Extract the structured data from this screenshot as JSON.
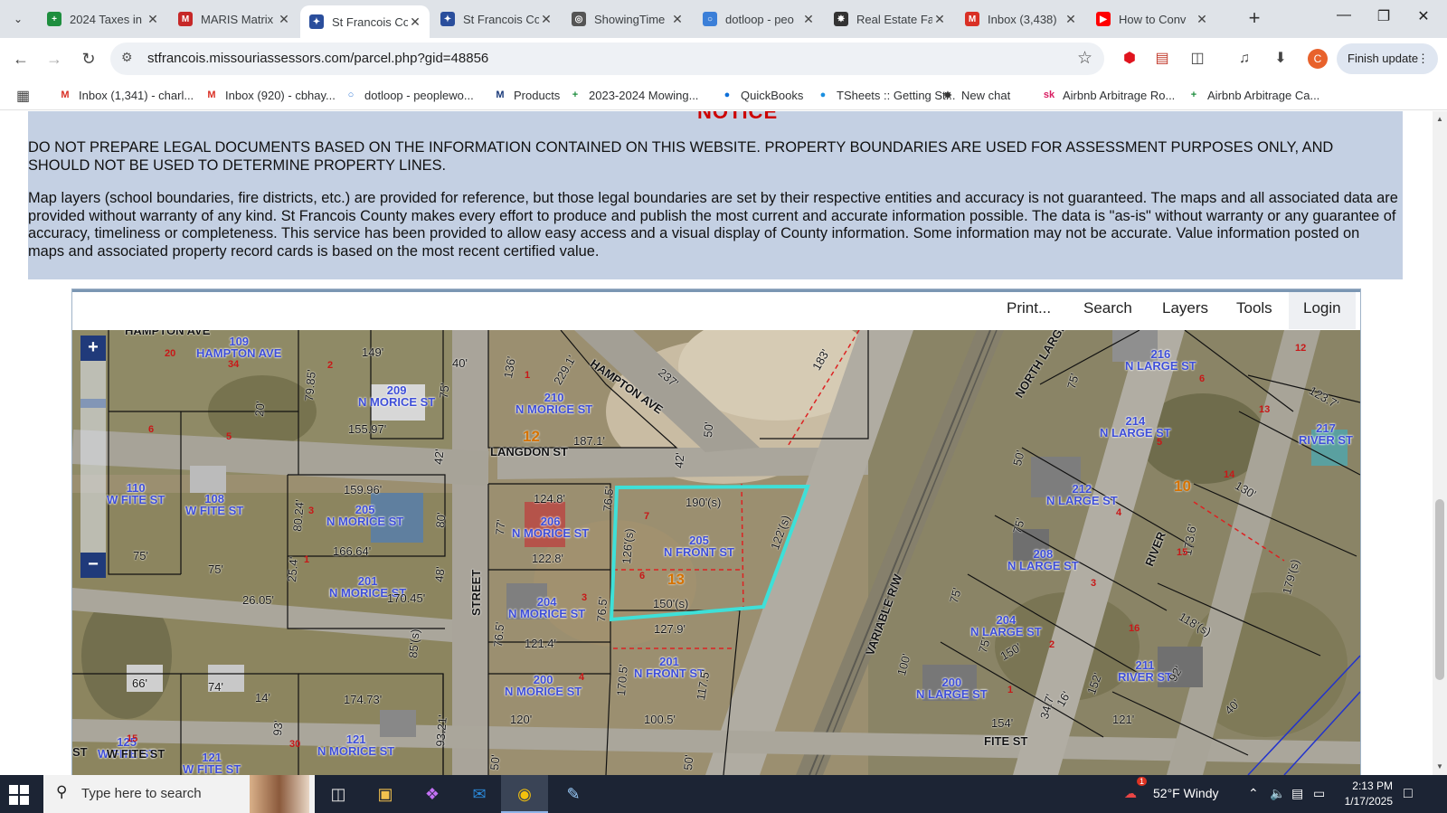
{
  "browser": {
    "tabs": [
      {
        "title": "2024 Taxes in",
        "icon": "sheets-icon",
        "color": "#1e8e3e",
        "glyph": "+"
      },
      {
        "title": "MARIS Matrix",
        "icon": "maris-icon",
        "color": "#c62828",
        "glyph": "M"
      },
      {
        "title": "St Francois Co",
        "icon": "county-seal-icon",
        "color": "#2a4e9c",
        "glyph": "✦"
      },
      {
        "title": "St Francois Co",
        "icon": "county-seal-icon",
        "color": "#2a4e9c",
        "glyph": "✦"
      },
      {
        "title": "ShowingTime",
        "icon": "globe-icon",
        "color": "#555555",
        "glyph": "◎"
      },
      {
        "title": "dotloop - peo",
        "icon": "dotloop-icon",
        "color": "#3b7fd8",
        "glyph": "○"
      },
      {
        "title": "Real Estate Fa",
        "icon": "chatgpt-icon",
        "color": "#333333",
        "glyph": "✸"
      },
      {
        "title": "Inbox (3,438)",
        "icon": "gmail-icon",
        "color": "#d93025",
        "glyph": "M"
      },
      {
        "title": "How to Conv",
        "icon": "youtube-icon",
        "color": "#ff0000",
        "glyph": "▶"
      }
    ],
    "active_tab_index": 2,
    "url": "stfrancois.missouriassessors.com/parcel.php?gid=48856",
    "profile_initial": "C",
    "finish_update_label": "Finish update",
    "bookmarks": [
      {
        "label": "Inbox (1,341) - charl...",
        "icon": "gmail-icon",
        "color": "#d93025",
        "glyph": "M"
      },
      {
        "label": "Inbox (920) - cbhay...",
        "icon": "gmail-icon",
        "color": "#d93025",
        "glyph": "M"
      },
      {
        "label": "dotloop - peoplewo...",
        "icon": "dotloop-icon",
        "color": "#3b7fd8",
        "glyph": "○"
      },
      {
        "label": "Products",
        "icon": "m-logo-icon",
        "color": "#1a3a7a",
        "glyph": "M"
      },
      {
        "label": "2023-2024 Mowing...",
        "icon": "sheets-icon",
        "color": "#1e8e3e",
        "glyph": "+"
      },
      {
        "label": "QuickBooks",
        "icon": "quickbooks-icon",
        "color": "#0d6fd8",
        "glyph": "●"
      },
      {
        "label": "TSheets :: Getting St...",
        "icon": "tsheets-icon",
        "color": "#1a8fe0",
        "glyph": "●"
      },
      {
        "label": "New chat",
        "icon": "chatgpt-icon",
        "color": "#333333",
        "glyph": "✸"
      },
      {
        "label": "Airbnb Arbitrage Ro...",
        "icon": "sk-icon",
        "color": "#d81b60",
        "glyph": "sk"
      },
      {
        "label": "Airbnb Arbitrage Ca...",
        "icon": "sheets-icon",
        "color": "#1e8e3e",
        "glyph": "+"
      }
    ]
  },
  "notice": {
    "heading": "NOTICE",
    "paragraph1": "DO NOT PREPARE LEGAL DOCUMENTS BASED ON THE INFORMATION CONTAINED ON THIS WEBSITE.  PROPERTY BOUNDARIES ARE USED FOR ASSESSMENT PURPOSES ONLY, AND SHOULD NOT BE USED TO DETERMINE PROPERTY LINES.",
    "paragraph2": "Map layers (school boundaries, fire districts, etc.) are provided for reference, but those legal boundaries are set by their respective entities and accuracy is not guaranteed.  The maps and all associated data are provided without warranty of any kind.  St Francois County makes every effort to produce and publish the most current and accurate information possible.  The data is \"as-is\" without warranty or any guarantee of accuracy, timeliness or completeness.  This service has been provided to allow easy access and a visual display of County information.  Some information may not be accurate.  Value information posted on maps and associated property record cards is based on the most recent certified value."
  },
  "map_toolbar": {
    "print": "Print...",
    "search": "Search",
    "layers": "Layers",
    "tools": "Tools",
    "login": "Login"
  },
  "map": {
    "zoom_in": "+",
    "zoom_out": "−",
    "highlight_color": "#3ee0d8",
    "parcel_labels": [
      {
        "num": "109",
        "street": "HAMPTON AVE"
      },
      {
        "num": "209",
        "street": "N MORICE ST"
      },
      {
        "num": "210",
        "street": "N MORICE ST"
      },
      {
        "num": "110",
        "street": "W FITE ST"
      },
      {
        "num": "108",
        "street": "W FITE ST"
      },
      {
        "num": "205",
        "street": "N MORICE ST"
      },
      {
        "num": "201",
        "street": "N MORICE ST"
      },
      {
        "num": "206",
        "street": "N MORICE ST"
      },
      {
        "num": "204",
        "street": "N MORICE ST"
      },
      {
        "num": "200",
        "street": "N MORICE ST"
      },
      {
        "num": "205",
        "street": "N FRONT ST"
      },
      {
        "num": "201",
        "street": "N FRONT ST"
      },
      {
        "num": "216",
        "street": "N LARGE ST"
      },
      {
        "num": "214",
        "street": "N LARGE ST"
      },
      {
        "num": "212",
        "street": "N LARGE ST"
      },
      {
        "num": "208",
        "street": "N LARGE ST"
      },
      {
        "num": "204",
        "street": "N LARGE ST"
      },
      {
        "num": "200",
        "street": "N LARGE ST"
      },
      {
        "num": "217",
        "street": "RIVER ST"
      },
      {
        "num": "211",
        "street": "RIVER ST"
      },
      {
        "num": "125",
        "street": "W FITE ST"
      },
      {
        "num": "121",
        "street": "W FITE ST"
      },
      {
        "num": "121",
        "street": "N MORICE ST"
      }
    ],
    "street_names": [
      "HAMPTON AVE",
      "HAMPTON AVE",
      "LANGDON ST",
      "STREET",
      "NORTH LARGE",
      "VARIABLE R/W",
      "RIVER",
      "FITE ST",
      "W FITE ST",
      "ST"
    ],
    "block_numbers": [
      "12",
      "13",
      "10"
    ],
    "dimensions": [
      "149'",
      "40'",
      "136'",
      "229.1'",
      "237'",
      "183'",
      "79.85'",
      "75'",
      "155.97'",
      "20'",
      "187.1'",
      "42'",
      "50'",
      "42'",
      "159.96'",
      "124.8'",
      "76.5'",
      "190'(s)",
      "122'(s)",
      "126'(s)",
      "80.24'",
      "80'",
      "77'",
      "122.8'",
      "150'(s)",
      "166.64'",
      "75'",
      "75'",
      "25.4'",
      "48'",
      "170.45'",
      "26.05'",
      "127.9'",
      "121.4'",
      "76.5'",
      "76.5'",
      "85'(s)",
      "66'",
      "74'",
      "14'",
      "174.73'",
      "170.5'",
      "117.5'",
      "100.5'",
      "120'",
      "93'",
      "93.21'",
      "50'",
      "50'",
      "75'",
      "75'",
      "150'",
      "152'",
      "154'",
      "34.7'",
      "16'",
      "121'",
      "40'",
      "92'",
      "118'(s)",
      "173.6'",
      "179'(s)",
      "130'",
      "123.7'",
      "100'",
      "75'",
      "50'",
      "75'"
    ]
  },
  "taskbar": {
    "search_placeholder": "Type here to search",
    "weather": "52°F  Windy",
    "time": "2:13 PM",
    "date": "1/17/2025",
    "notification_badge": "1"
  }
}
